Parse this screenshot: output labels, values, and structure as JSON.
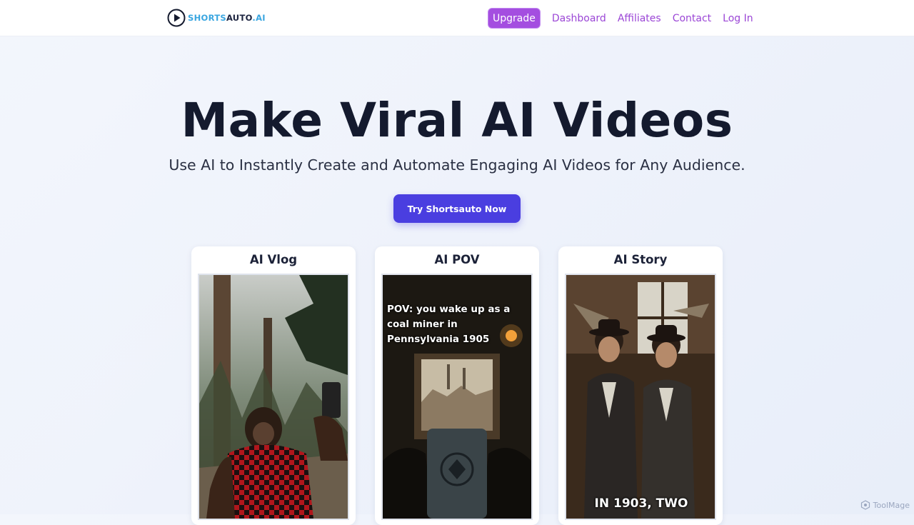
{
  "brand": {
    "name_part1": "SHORTS",
    "name_part2": "AUTO",
    "name_part3": ".AI"
  },
  "nav": {
    "upgrade": "Upgrade",
    "dashboard": "Dashboard",
    "affiliates": "Affiliates",
    "contact": "Contact",
    "login": "Log In"
  },
  "hero": {
    "title": "Make Viral AI Videos",
    "subtitle": "Use AI to Instantly Create and Automate Engaging AI Videos for Any Audience.",
    "cta": "Try Shortsauto Now"
  },
  "cards": [
    {
      "title": "AI Vlog",
      "overlay": ""
    },
    {
      "title": "AI POV",
      "overlay": "POV: you wake up as a coal miner in Pennsylvania 1905"
    },
    {
      "title": "AI Story",
      "overlay": "IN 1903, TWO"
    }
  ],
  "watermark": "ToolMage",
  "colors": {
    "accent_purple": "#a44ee0",
    "cta_blue": "#4a3ee0",
    "brand_blue": "#3aa6e0"
  }
}
